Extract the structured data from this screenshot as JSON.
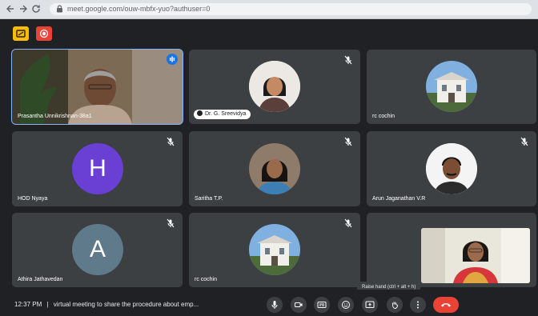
{
  "browser": {
    "url": "meet.google.com/ouw-mbfx-yuo?authuser=0"
  },
  "icons": {
    "back": "arrow-left-icon",
    "forward": "arrow-right-icon",
    "reload": "reload-icon",
    "lock": "lock-icon"
  },
  "participants": [
    {
      "name": "Prasantha Unnikrishnan-38a1",
      "kind": "video",
      "speaking": true
    },
    {
      "name": "Dr. G. Sreevidya",
      "kind": "photo",
      "muted": true
    },
    {
      "name": "rc cochin",
      "kind": "photo",
      "muted": false
    },
    {
      "name": "HOD Nyaya",
      "kind": "letter",
      "letter": "H",
      "avatar_color": "#6a3fd4",
      "muted": true
    },
    {
      "name": "Saritha T.P.",
      "kind": "photo",
      "muted": true
    },
    {
      "name": "Arun Jaganathan V.R",
      "kind": "photo",
      "muted": true
    },
    {
      "name": "Athira Jathavedan",
      "kind": "letter",
      "letter": "A",
      "avatar_color": "#5f7a8a",
      "muted": true
    },
    {
      "name": "rc cochin",
      "kind": "photo",
      "muted": true
    }
  ],
  "bottom": {
    "time": "12:37 PM",
    "separator": "|",
    "meeting_title": "virtual meeting to share the procedure about emp...",
    "tooltip": "Raise hand (ctrl + alt + h)"
  },
  "colors": {
    "accent": "#8ab4f8",
    "end_call": "#ea4335",
    "tile": "#3c4043",
    "background": "#202124"
  }
}
